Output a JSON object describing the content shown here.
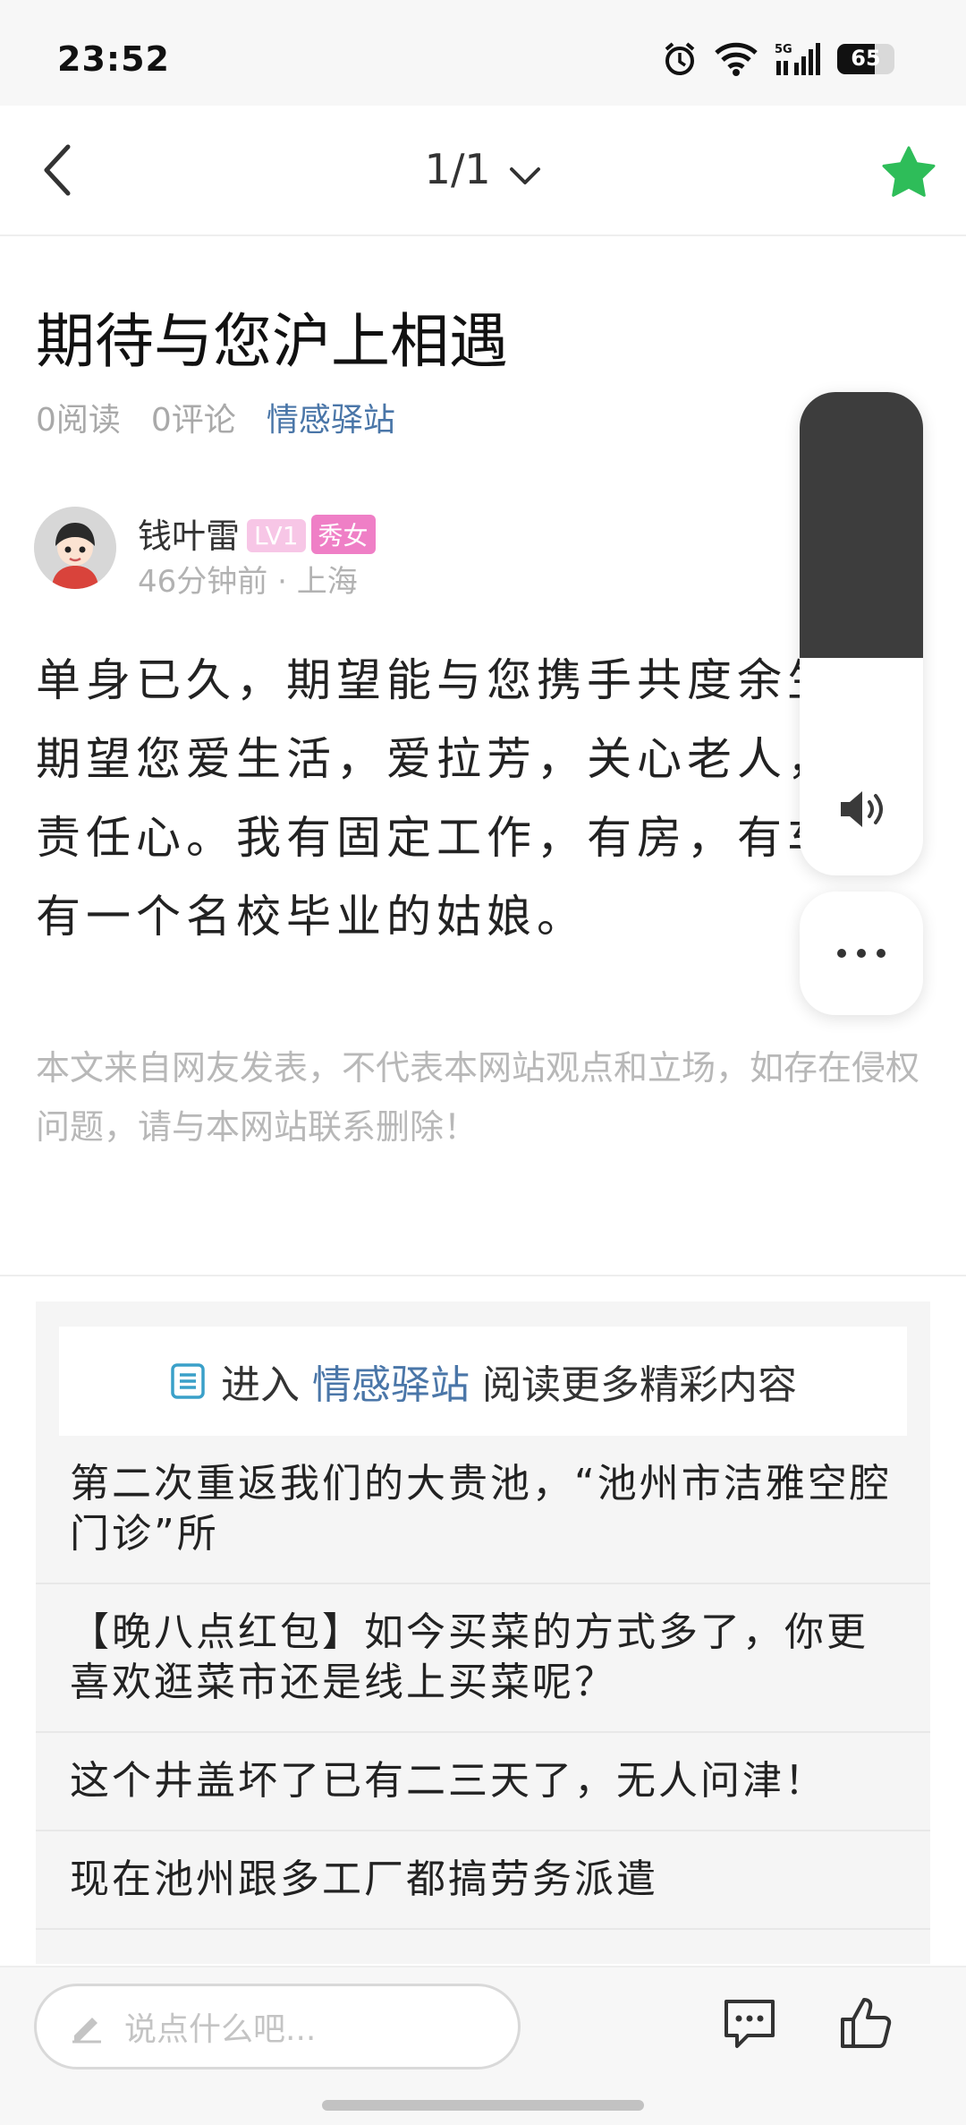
{
  "status_bar": {
    "time": "23:52",
    "battery": "65",
    "network": "5G",
    "icons": [
      "alarm-icon",
      "wifi-icon",
      "signal-icon",
      "battery-icon"
    ]
  },
  "nav": {
    "page_indicator": "1/1",
    "favorite_color": "#2ebd59"
  },
  "article": {
    "title": "期待与您沪上相遇",
    "reads": "0阅读",
    "comments": "0评论",
    "category": "情感驿站",
    "author": {
      "name": "钱叶雷",
      "level": "LV1",
      "tag": "秀女",
      "time": "46分钟前",
      "location": "上海"
    },
    "body": "单身已久，期望能与您携手共度余生。期望您爱生活，爱拉芳，关心老人，有责任心。我有固定工作，有房，有车，有一个名校毕业的姑娘。",
    "disclaimer": "本文来自网友发表，不代表本网站观点和立场，如存在侵权问题，请与本网站联系删除！"
  },
  "volume": {
    "level": 0.55
  },
  "related": {
    "enter_prefix": "进入",
    "enter_section": "情感驿站",
    "enter_suffix": "阅读更多精彩内容",
    "items": [
      "第二次重返我们的大贵池，“池州市洁雅空腔门诊”所",
      "【晚八点红包】如今买菜的方式多了，你更喜欢逛菜市还是线上买菜呢？",
      "这个井盖坏了已有二三天了，无人问津！",
      "现在池州跟多工厂都搞劳务派遣"
    ]
  },
  "bottom_bar": {
    "comment_placeholder": "说点什么吧..."
  },
  "colors": {
    "accent_blue": "#4a76a8",
    "star_green": "#2ebd59",
    "badge_pink": "#ef7fc6"
  }
}
